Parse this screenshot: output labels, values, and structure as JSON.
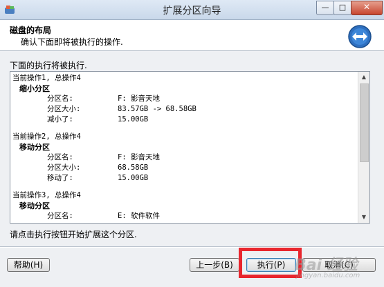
{
  "window": {
    "title": "扩展分区向导",
    "minimize_symbol": "—",
    "maximize_symbol": "□",
    "close_symbol": "✕"
  },
  "header": {
    "title": "磁盘的布局",
    "subtitle": "确认下面即将被执行的操作.",
    "icon": "left-right-arrows-icon"
  },
  "body": {
    "instruction": "下面的执行将被执行.",
    "operations": [
      {
        "head": "当前操作1, 总操作4",
        "name": "缩小分区",
        "rows": [
          {
            "key": "分区名:",
            "value": "F: 影音天地"
          },
          {
            "key": "分区大小:",
            "value": "83.57GB -> 68.58GB"
          },
          {
            "key": "减小了:",
            "value": "15.00GB"
          }
        ]
      },
      {
        "head": "当前操作2, 总操作4",
        "name": "移动分区",
        "rows": [
          {
            "key": "分区名:",
            "value": "F: 影音天地"
          },
          {
            "key": "分区大小:",
            "value": "68.58GB"
          },
          {
            "key": "移动了:",
            "value": "15.00GB"
          }
        ]
      },
      {
        "head": "当前操作3, 总操作4",
        "name": "移动分区",
        "rows": [
          {
            "key": "分区名:",
            "value": "E: 软件软件"
          }
        ]
      }
    ],
    "footer_note": "请点击执行按钮开始扩展这个分区."
  },
  "buttons": {
    "help": "帮助(H)",
    "back": "上一步(B)",
    "execute": "执行(P)",
    "cancel": "取消(C)"
  },
  "watermark": {
    "logo": "Bai 经验",
    "site": "jingyan.baidu.com"
  },
  "colors": {
    "highlight": "#e8262e",
    "close_button": "#c8462f"
  }
}
